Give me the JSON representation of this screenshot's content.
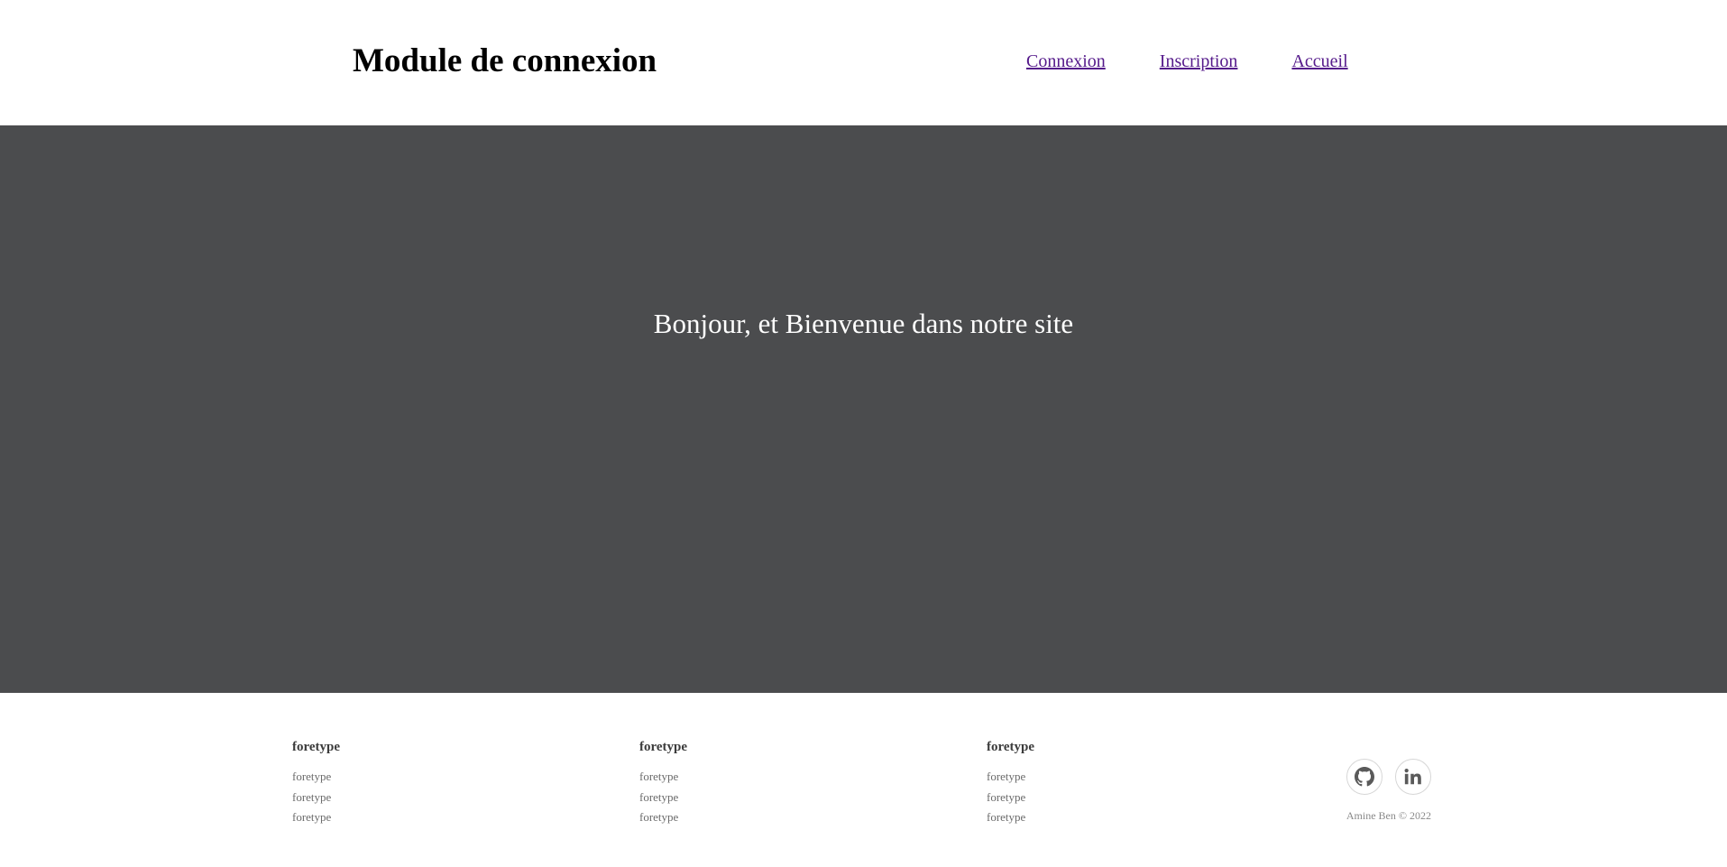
{
  "header": {
    "title": "Module de connexion",
    "nav": [
      {
        "label": "Connexion"
      },
      {
        "label": "Inscription"
      },
      {
        "label": "Accueil"
      }
    ]
  },
  "hero": {
    "message": "Bonjour, et Bienvenue dans notre site"
  },
  "footer": {
    "columns": [
      {
        "heading": "foretype",
        "links": [
          "foretype",
          "foretype",
          "foretype"
        ]
      },
      {
        "heading": "foretype",
        "links": [
          "foretype",
          "foretype",
          "foretype"
        ]
      },
      {
        "heading": "foretype",
        "links": [
          "foretype",
          "foretype",
          "foretype"
        ]
      }
    ],
    "social": [
      {
        "icon": "github-icon"
      },
      {
        "icon": "linkedin-icon"
      }
    ],
    "copyright": "Amine Ben © 2022"
  },
  "colors": {
    "hero_background": "#4b4c4e",
    "link": "#551a8b",
    "footer_heading": "#3c3c3c",
    "footer_link": "#6b6b6b"
  }
}
